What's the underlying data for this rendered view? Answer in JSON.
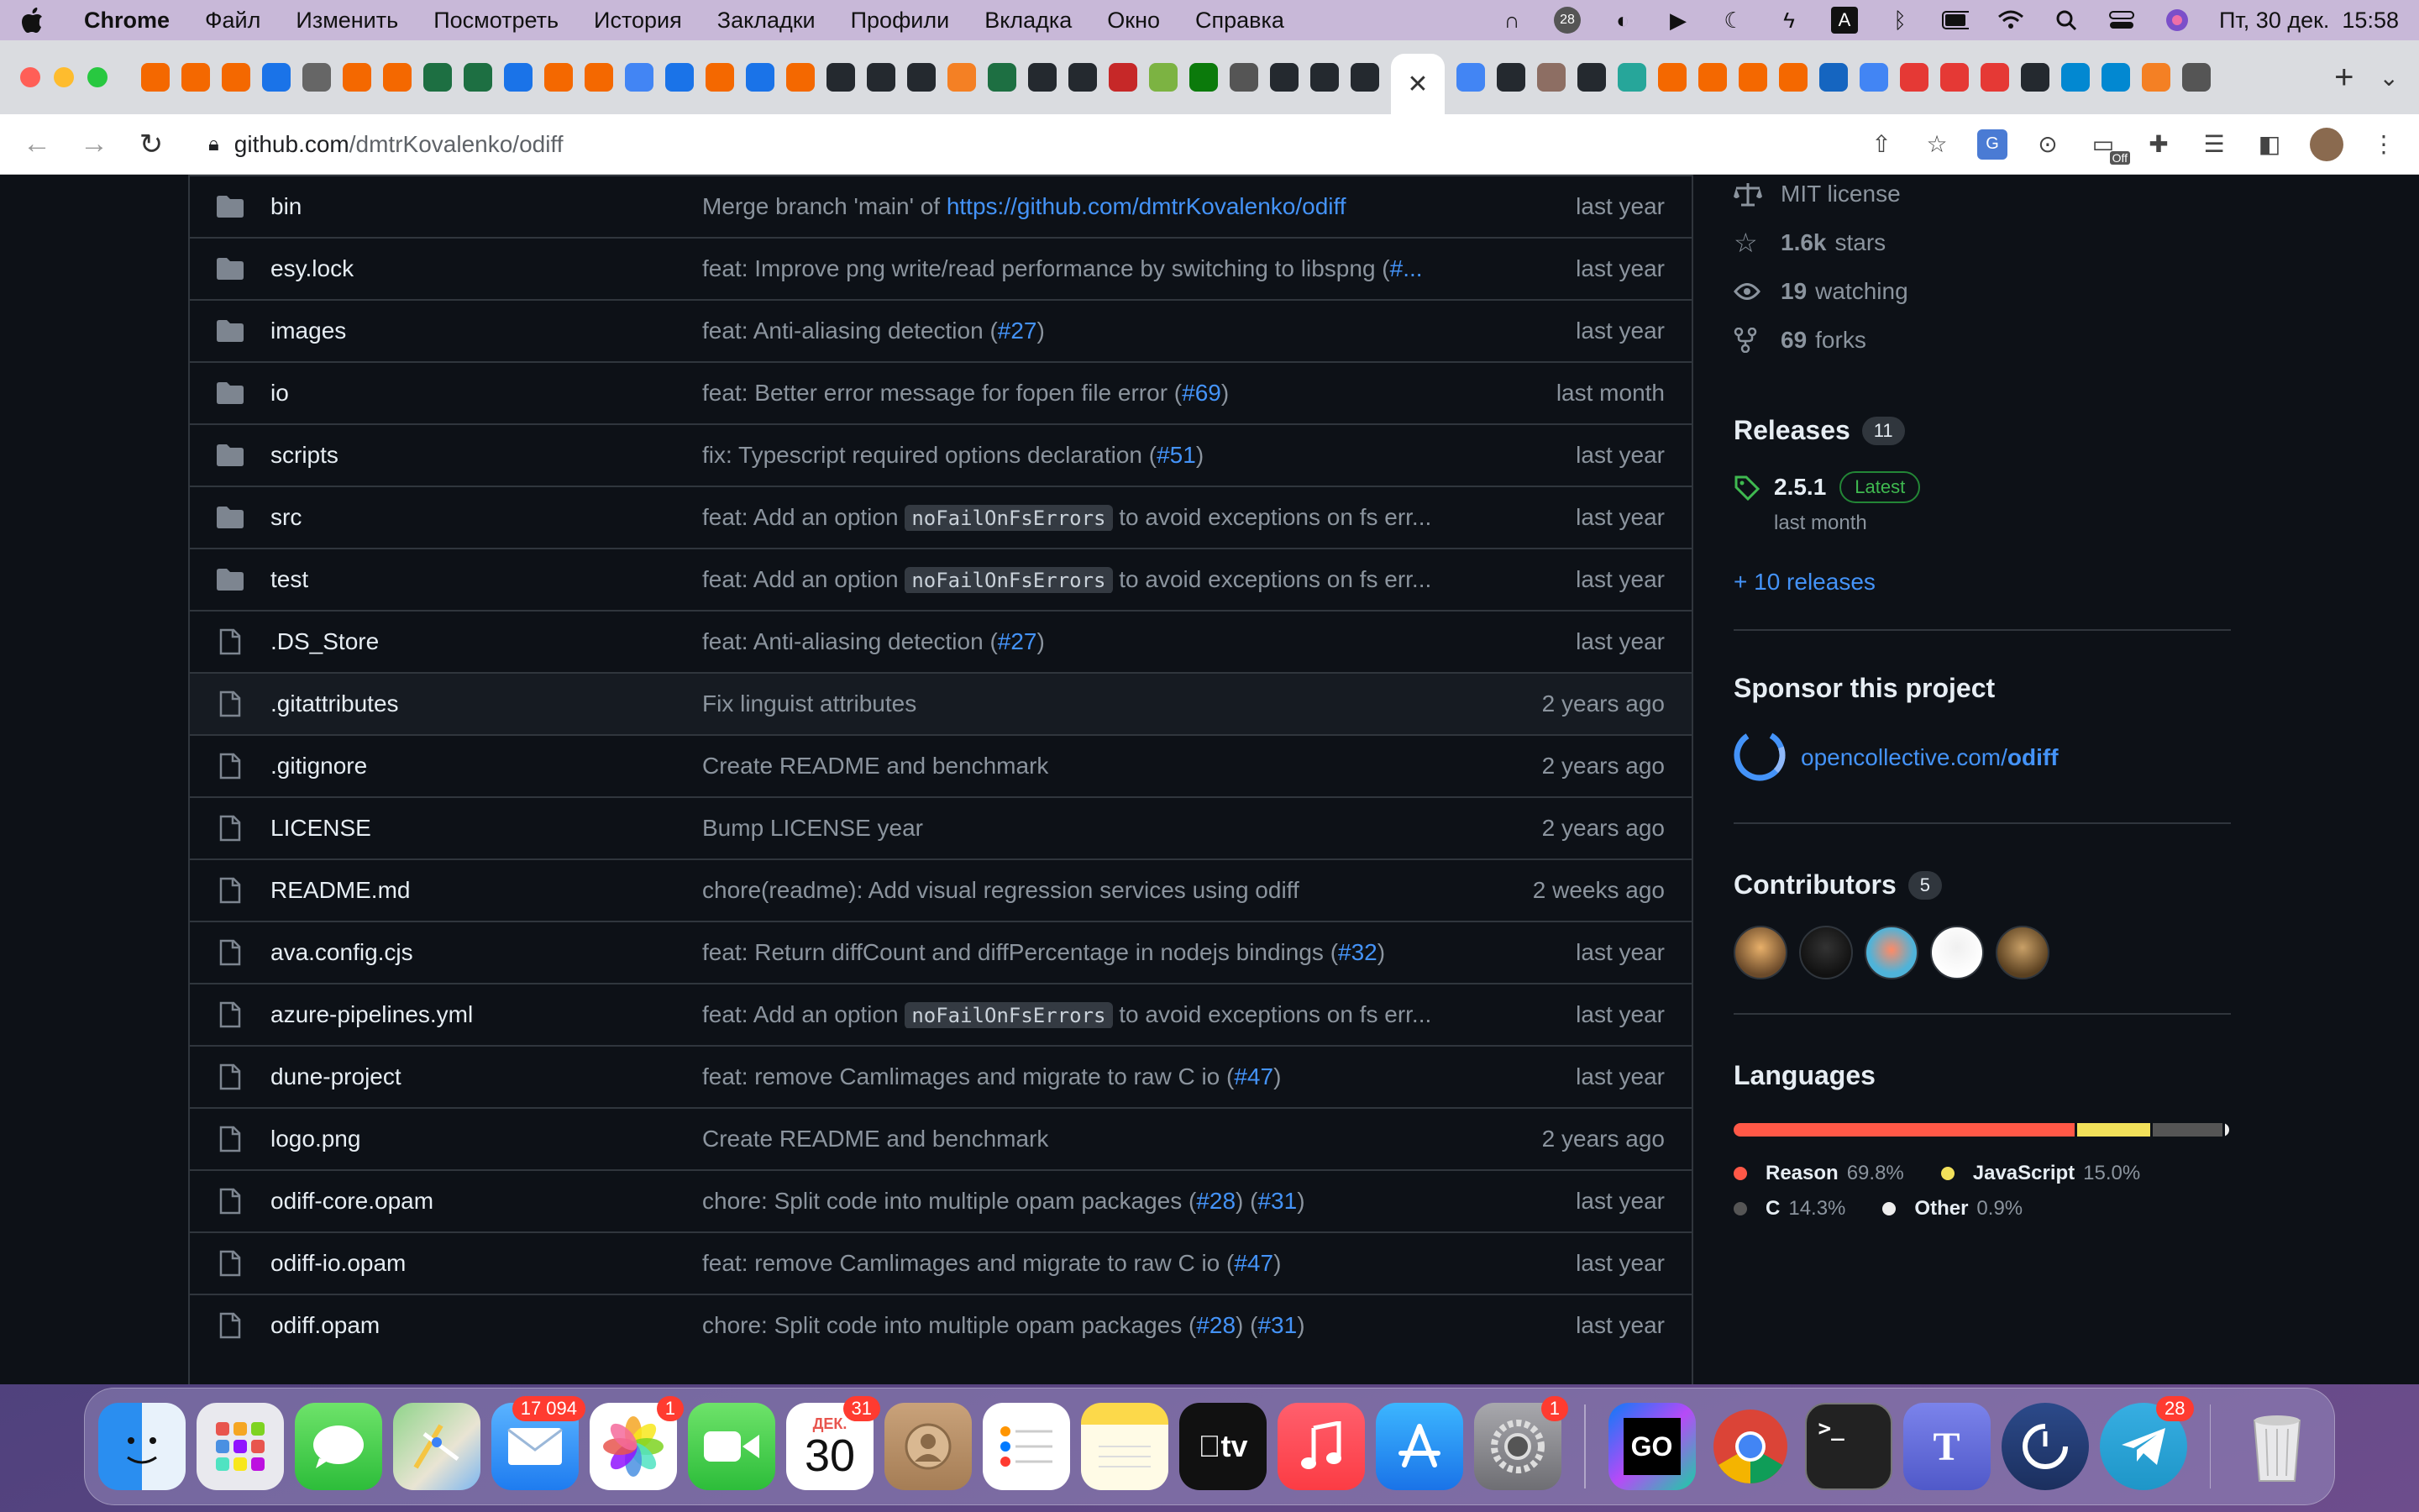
{
  "menubar": {
    "app_name": "Chrome",
    "items": [
      "Файл",
      "Изменить",
      "Посмотреть",
      "История",
      "Закладки",
      "Профили",
      "Вкладка",
      "Окно",
      "Справка"
    ],
    "notif_badge": "28",
    "input_source": "A",
    "datetime": "Пт, 30 дек.  15:58"
  },
  "browser": {
    "active_tab_close": "✕",
    "new_tab": "+",
    "url_host": "github.com",
    "url_path": "/dmtrKovalenko/odiff",
    "ext_off_badge": "Off"
  },
  "files": [
    {
      "name": "bin",
      "type": "dir",
      "msg_pre": "Merge branch 'main' of ",
      "msg_link": "https://github.com/dmtrKovalenko/odiff",
      "msg_post": "",
      "age": "last year"
    },
    {
      "name": "esy.lock",
      "type": "dir",
      "msg_pre": "feat: Improve png write/read performance by switching to libspng (",
      "msg_link": "#...",
      "msg_post": "",
      "age": "last year"
    },
    {
      "name": "images",
      "type": "dir",
      "msg_pre": "feat: Anti-aliasing detection (",
      "msg_link": "#27",
      "msg_post": ")",
      "age": "last year"
    },
    {
      "name": "io",
      "type": "dir",
      "msg_pre": "feat: Better error message for fopen file error (",
      "msg_link": "#69",
      "msg_post": ")",
      "age": "last month"
    },
    {
      "name": "scripts",
      "type": "dir",
      "msg_pre": "fix: Typescript required options declaration (",
      "msg_link": "#51",
      "msg_post": ")",
      "age": "last year"
    },
    {
      "name": "src",
      "type": "dir",
      "msg_pre": "feat: Add an option ",
      "msg_code": "noFailOnFsErrors",
      "msg_post": " to avoid exceptions on fs err...",
      "age": "last year"
    },
    {
      "name": "test",
      "type": "dir",
      "msg_pre": "feat: Add an option ",
      "msg_code": "noFailOnFsErrors",
      "msg_post": " to avoid exceptions on fs err...",
      "age": "last year"
    },
    {
      "name": ".DS_Store",
      "type": "file",
      "msg_pre": "feat: Anti-aliasing detection (",
      "msg_link": "#27",
      "msg_post": ")",
      "age": "last year"
    },
    {
      "name": ".gitattributes",
      "type": "file",
      "msg_pre": "Fix linguist attributes",
      "msg_post": "",
      "age": "2 years ago"
    },
    {
      "name": ".gitignore",
      "type": "file",
      "msg_pre": "Create README and benchmark",
      "msg_post": "",
      "age": "2 years ago"
    },
    {
      "name": "LICENSE",
      "type": "file",
      "msg_pre": "Bump LICENSE year",
      "msg_post": "",
      "age": "2 years ago"
    },
    {
      "name": "README.md",
      "type": "file",
      "msg_pre": "chore(readme): Add visual regression services using odiff",
      "msg_post": "",
      "age": "2 weeks ago"
    },
    {
      "name": "ava.config.cjs",
      "type": "file",
      "msg_pre": "feat: Return diffCount and diffPercentage in nodejs bindings (",
      "msg_link": "#32",
      "msg_post": ")",
      "age": "last year"
    },
    {
      "name": "azure-pipelines.yml",
      "type": "file",
      "msg_pre": "feat: Add an option ",
      "msg_code": "noFailOnFsErrors",
      "msg_post": " to avoid exceptions on fs err...",
      "age": "last year"
    },
    {
      "name": "dune-project",
      "type": "file",
      "msg_pre": "feat: remove Camlimages and migrate to raw C io (",
      "msg_link": "#47",
      "msg_post": ")",
      "age": "last year"
    },
    {
      "name": "logo.png",
      "type": "file",
      "msg_pre": "Create README and benchmark",
      "msg_post": "",
      "age": "2 years ago"
    },
    {
      "name": "odiff-core.opam",
      "type": "file",
      "msg_pre": "chore: Split code into multiple opam packages (",
      "msg_link": "#28",
      "msg_mid": ") (",
      "msg_link2": "#31",
      "msg_post": ")",
      "age": "last year"
    },
    {
      "name": "odiff-io.opam",
      "type": "file",
      "msg_pre": "feat: remove Camlimages and migrate to raw C io (",
      "msg_link": "#47",
      "msg_post": ")",
      "age": "last year"
    },
    {
      "name": "odiff.opam",
      "type": "file",
      "msg_pre": "chore: Split code into multiple opam packages (",
      "msg_link": "#28",
      "msg_mid": ") (",
      "msg_link2": "#31",
      "msg_post": ")",
      "age": "last year"
    }
  ],
  "about": {
    "license": "MIT license",
    "stars_count": "1.6k",
    "stars_label": "stars",
    "watching_count": "19",
    "watching_label": "watching",
    "forks_count": "69",
    "forks_label": "forks"
  },
  "releases": {
    "title": "Releases",
    "count": "11",
    "latest_version": "2.5.1",
    "latest_badge": "Latest",
    "latest_date": "last month",
    "more_link": "+ 10 releases"
  },
  "sponsor": {
    "title": "Sponsor this project",
    "link_host": "opencollective.com/",
    "link_path": "odiff"
  },
  "contributors": {
    "title": "Contributors",
    "count": "5"
  },
  "languages": {
    "title": "Languages",
    "items": [
      {
        "name": "Reason",
        "pct": "69.8%",
        "value": 69.8,
        "color": "#ff5847"
      },
      {
        "name": "JavaScript",
        "pct": "15.0%",
        "value": 15.0,
        "color": "#f1e05a"
      },
      {
        "name": "C",
        "pct": "14.3%",
        "value": 14.3,
        "color": "#555555"
      },
      {
        "name": "Other",
        "pct": "0.9%",
        "value": 0.9,
        "color": "#ededed"
      }
    ]
  },
  "dock": {
    "mail_badge": "17 094",
    "photos_badge": "1",
    "calendar_month": "ДЕК.",
    "calendar_day": "30",
    "calendar_badge": "31",
    "tv_label": "tv",
    "settings_badge": "1",
    "goland_label": "GO",
    "terminal_label": ">_",
    "telegram_badge": "28"
  }
}
